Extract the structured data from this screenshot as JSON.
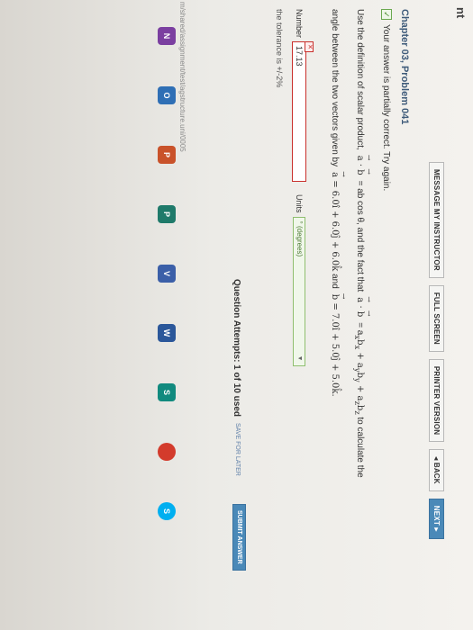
{
  "page_header": "nt",
  "toolbar": {
    "message": "MESSAGE MY INSTRUCTOR",
    "full_screen": "FULL SCREEN",
    "printer": "PRINTER VERSION",
    "back": "◂ BACK",
    "next": "NEXT ▸"
  },
  "problem": {
    "title": "Chapter 03, Problem 041",
    "status": "Your answer is partially correct.  Try again.",
    "line1_a": "Use the definition of scalar product,",
    "line1_b": "= ab cos θ, and the fact that",
    "line1_c": "= a",
    "line1_d": " to calculate the",
    "line2_a": "angle between the two vectors given by",
    "line2_b": "= 6.0î + 6.0ĵ + 6.0k̂",
    "line2_c": "and",
    "line2_d": "= 7.0î + 5.0ĵ + 5.0k̂."
  },
  "answer": {
    "number_label": "Number",
    "number_value": "17.13",
    "units_label": "Units",
    "units_value": "° (degrees)",
    "tolerance": "the tolerance is +/-2%"
  },
  "footer": {
    "attempts": "Question Attempts: 1 of 10 used",
    "save_later": "SAVE FOR LATER",
    "submit": "SUBMIT ANSWER",
    "url": "m/shared/assignment/test/agstructure.uni/0005"
  },
  "taskbar": {
    "onenote": "N",
    "outlook": "O",
    "ppt": "P",
    "pub": "P",
    "visio": "V",
    "word": "W",
    "sway": "S",
    "chrome": "",
    "skype": "S"
  }
}
